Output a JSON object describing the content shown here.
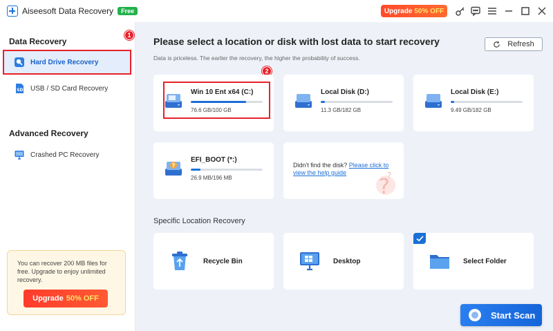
{
  "app": {
    "title": "Aiseesoft Data Recovery",
    "free_badge": "Free",
    "upgrade_label": "Upgrade",
    "upgrade_pct": "50% OFF"
  },
  "titlebar_icons": [
    "key-icon",
    "feedback-icon",
    "menu-icon",
    "minimize-icon",
    "maximize-icon",
    "close-icon"
  ],
  "sidebar": {
    "data_recovery_heading": "Data Recovery",
    "items": [
      {
        "label": "Hard Drive Recovery",
        "icon": "hard-drive-icon",
        "active": true
      },
      {
        "label": "USB / SD Card Recovery",
        "icon": "sd-card-icon",
        "active": false
      }
    ],
    "advanced_heading": "Advanced Recovery",
    "advanced_items": [
      {
        "label": "Crashed PC Recovery",
        "icon": "monitor-icon"
      }
    ],
    "badge_1": "1",
    "promo": {
      "text": "You can recover 200 MB files for free. Upgrade to enjoy unlimited recovery.",
      "button_label": "Upgrade",
      "button_pct": "50% OFF"
    }
  },
  "main": {
    "title": "Please select a location or disk with lost data to start recovery",
    "subtitle": "Data is priceless. The earlier the recovery, the higher the probability of success.",
    "refresh_label": "Refresh",
    "badge_2": "2",
    "disks": [
      {
        "name": "Win 10 Ent x64 (C:)",
        "size": "76.6 GB/100 GB",
        "fill": 0.766
      },
      {
        "name": "Local Disk (D:)",
        "size": "11.3 GB/182 GB",
        "fill": 0.062
      },
      {
        "name": "Local Disk (E:)",
        "size": "9.49 GB/182 GB",
        "fill": 0.052
      },
      {
        "name": "EFI_BOOT (*:)",
        "size": "26.9 MB/196 MB",
        "fill": 0.137
      }
    ],
    "help": {
      "text": "Didn't find the disk?",
      "link_part1": "Please click to",
      "link_part2": "view the help guide"
    },
    "specific_title": "Specific Location Recovery",
    "locations": [
      {
        "label": "Recycle Bin",
        "icon": "recycle-bin-icon"
      },
      {
        "label": "Desktop",
        "icon": "desktop-icon"
      },
      {
        "label": "Select Folder",
        "icon": "folder-icon"
      }
    ],
    "start_scan_label": "Start Scan"
  },
  "colors": {
    "accent": "#1a6fd6",
    "highlight": "#e8202a",
    "upgrade": "#ff4b2b",
    "free": "#23b14d"
  }
}
